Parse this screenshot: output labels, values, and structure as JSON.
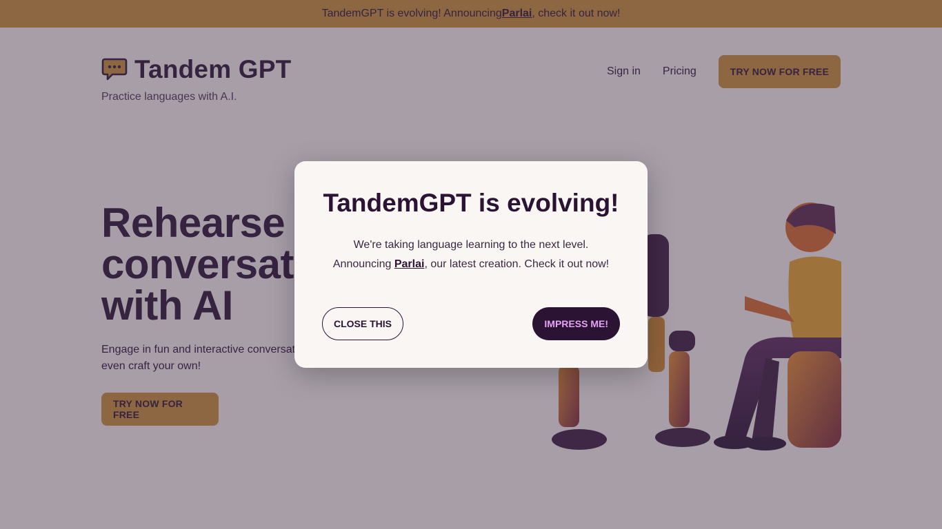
{
  "banner": {
    "prefix": "TandemGPT is evolving! Announcing ",
    "link": "Parlai",
    "suffix": ", check it out now!"
  },
  "header": {
    "logo_text": "Tandem GPT",
    "tagline": "Practice languages with A.I.",
    "logo_icon": "speech-bubble-icon"
  },
  "nav": {
    "sign_in": "Sign in",
    "pricing": "Pricing",
    "cta": "TRY NOW FOR FREE"
  },
  "hero": {
    "title_line1": "Rehearse real",
    "title_line2": "conversations",
    "title_line3": "with AI",
    "subtitle": "Engage in fun and interactive conversations, choose from scenarios, or even craft your own!",
    "cta": "TRY NOW FOR FREE"
  },
  "modal": {
    "title": "TandemGPT is evolving!",
    "line1": "We're taking language learning to the next level.",
    "line2_prefix": "Announcing ",
    "line2_link": "Parlai",
    "line2_suffix": ", our latest creation. Check it out now!",
    "close_label": "CLOSE THIS",
    "impress_label": "IMPRESS ME!"
  },
  "colors": {
    "brand_gold": "#c98f36",
    "brand_dark": "#2a1333",
    "accent_pink": "#e6a3f5",
    "background": "#faf6f3"
  }
}
